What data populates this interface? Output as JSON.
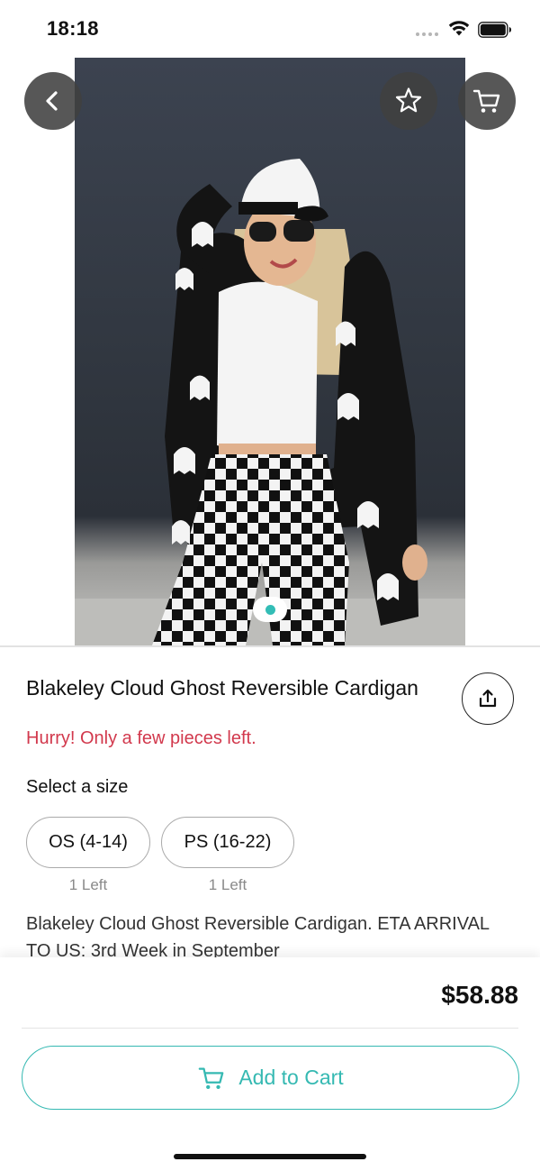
{
  "status_bar": {
    "time": "18:18",
    "icons": [
      "signal-dots-icon",
      "wifi-icon",
      "battery-icon"
    ]
  },
  "header": {
    "back_icon": "chevron-left-icon",
    "favorite_icon": "star-icon",
    "cart_icon": "cart-icon",
    "button_color": "#404040"
  },
  "gallery": {
    "page_count": 1,
    "current_page": 1,
    "indicator_color": "#33bdb6"
  },
  "product": {
    "title": "Blakeley Cloud Ghost Reversible Cardigan",
    "urgency": "Hurry! Only a few pieces left.",
    "urgency_color": "#d2394d",
    "size_prompt": "Select a size",
    "sizes": [
      {
        "label": "OS (4-14)",
        "stock": "1 Left"
      },
      {
        "label": "PS (16-22)",
        "stock": "1 Left"
      }
    ],
    "description": "Blakeley Cloud Ghost Reversible Cardigan. ETA ARRIVAL TO US: 3rd Week in September",
    "share_icon": "share-icon"
  },
  "purchase": {
    "price": "$58.88",
    "add_to_cart_label": "Add to Cart",
    "add_to_cart_icon": "cart-icon",
    "accent_color": "#35b9b2"
  }
}
